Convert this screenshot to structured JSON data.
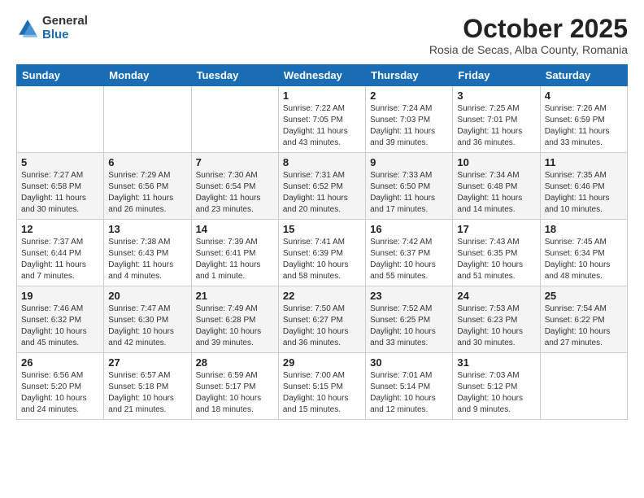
{
  "header": {
    "logo_general": "General",
    "logo_blue": "Blue",
    "month_title": "October 2025",
    "subtitle": "Rosia de Secas, Alba County, Romania"
  },
  "weekdays": [
    "Sunday",
    "Monday",
    "Tuesday",
    "Wednesday",
    "Thursday",
    "Friday",
    "Saturday"
  ],
  "weeks": [
    [
      {
        "day": "",
        "info": ""
      },
      {
        "day": "",
        "info": ""
      },
      {
        "day": "",
        "info": ""
      },
      {
        "day": "1",
        "info": "Sunrise: 7:22 AM\nSunset: 7:05 PM\nDaylight: 11 hours and 43 minutes."
      },
      {
        "day": "2",
        "info": "Sunrise: 7:24 AM\nSunset: 7:03 PM\nDaylight: 11 hours and 39 minutes."
      },
      {
        "day": "3",
        "info": "Sunrise: 7:25 AM\nSunset: 7:01 PM\nDaylight: 11 hours and 36 minutes."
      },
      {
        "day": "4",
        "info": "Sunrise: 7:26 AM\nSunset: 6:59 PM\nDaylight: 11 hours and 33 minutes."
      }
    ],
    [
      {
        "day": "5",
        "info": "Sunrise: 7:27 AM\nSunset: 6:58 PM\nDaylight: 11 hours and 30 minutes."
      },
      {
        "day": "6",
        "info": "Sunrise: 7:29 AM\nSunset: 6:56 PM\nDaylight: 11 hours and 26 minutes."
      },
      {
        "day": "7",
        "info": "Sunrise: 7:30 AM\nSunset: 6:54 PM\nDaylight: 11 hours and 23 minutes."
      },
      {
        "day": "8",
        "info": "Sunrise: 7:31 AM\nSunset: 6:52 PM\nDaylight: 11 hours and 20 minutes."
      },
      {
        "day": "9",
        "info": "Sunrise: 7:33 AM\nSunset: 6:50 PM\nDaylight: 11 hours and 17 minutes."
      },
      {
        "day": "10",
        "info": "Sunrise: 7:34 AM\nSunset: 6:48 PM\nDaylight: 11 hours and 14 minutes."
      },
      {
        "day": "11",
        "info": "Sunrise: 7:35 AM\nSunset: 6:46 PM\nDaylight: 11 hours and 10 minutes."
      }
    ],
    [
      {
        "day": "12",
        "info": "Sunrise: 7:37 AM\nSunset: 6:44 PM\nDaylight: 11 hours and 7 minutes."
      },
      {
        "day": "13",
        "info": "Sunrise: 7:38 AM\nSunset: 6:43 PM\nDaylight: 11 hours and 4 minutes."
      },
      {
        "day": "14",
        "info": "Sunrise: 7:39 AM\nSunset: 6:41 PM\nDaylight: 11 hours and 1 minute."
      },
      {
        "day": "15",
        "info": "Sunrise: 7:41 AM\nSunset: 6:39 PM\nDaylight: 10 hours and 58 minutes."
      },
      {
        "day": "16",
        "info": "Sunrise: 7:42 AM\nSunset: 6:37 PM\nDaylight: 10 hours and 55 minutes."
      },
      {
        "day": "17",
        "info": "Sunrise: 7:43 AM\nSunset: 6:35 PM\nDaylight: 10 hours and 51 minutes."
      },
      {
        "day": "18",
        "info": "Sunrise: 7:45 AM\nSunset: 6:34 PM\nDaylight: 10 hours and 48 minutes."
      }
    ],
    [
      {
        "day": "19",
        "info": "Sunrise: 7:46 AM\nSunset: 6:32 PM\nDaylight: 10 hours and 45 minutes."
      },
      {
        "day": "20",
        "info": "Sunrise: 7:47 AM\nSunset: 6:30 PM\nDaylight: 10 hours and 42 minutes."
      },
      {
        "day": "21",
        "info": "Sunrise: 7:49 AM\nSunset: 6:28 PM\nDaylight: 10 hours and 39 minutes."
      },
      {
        "day": "22",
        "info": "Sunrise: 7:50 AM\nSunset: 6:27 PM\nDaylight: 10 hours and 36 minutes."
      },
      {
        "day": "23",
        "info": "Sunrise: 7:52 AM\nSunset: 6:25 PM\nDaylight: 10 hours and 33 minutes."
      },
      {
        "day": "24",
        "info": "Sunrise: 7:53 AM\nSunset: 6:23 PM\nDaylight: 10 hours and 30 minutes."
      },
      {
        "day": "25",
        "info": "Sunrise: 7:54 AM\nSunset: 6:22 PM\nDaylight: 10 hours and 27 minutes."
      }
    ],
    [
      {
        "day": "26",
        "info": "Sunrise: 6:56 AM\nSunset: 5:20 PM\nDaylight: 10 hours and 24 minutes."
      },
      {
        "day": "27",
        "info": "Sunrise: 6:57 AM\nSunset: 5:18 PM\nDaylight: 10 hours and 21 minutes."
      },
      {
        "day": "28",
        "info": "Sunrise: 6:59 AM\nSunset: 5:17 PM\nDaylight: 10 hours and 18 minutes."
      },
      {
        "day": "29",
        "info": "Sunrise: 7:00 AM\nSunset: 5:15 PM\nDaylight: 10 hours and 15 minutes."
      },
      {
        "day": "30",
        "info": "Sunrise: 7:01 AM\nSunset: 5:14 PM\nDaylight: 10 hours and 12 minutes."
      },
      {
        "day": "31",
        "info": "Sunrise: 7:03 AM\nSunset: 5:12 PM\nDaylight: 10 hours and 9 minutes."
      },
      {
        "day": "",
        "info": ""
      }
    ]
  ]
}
